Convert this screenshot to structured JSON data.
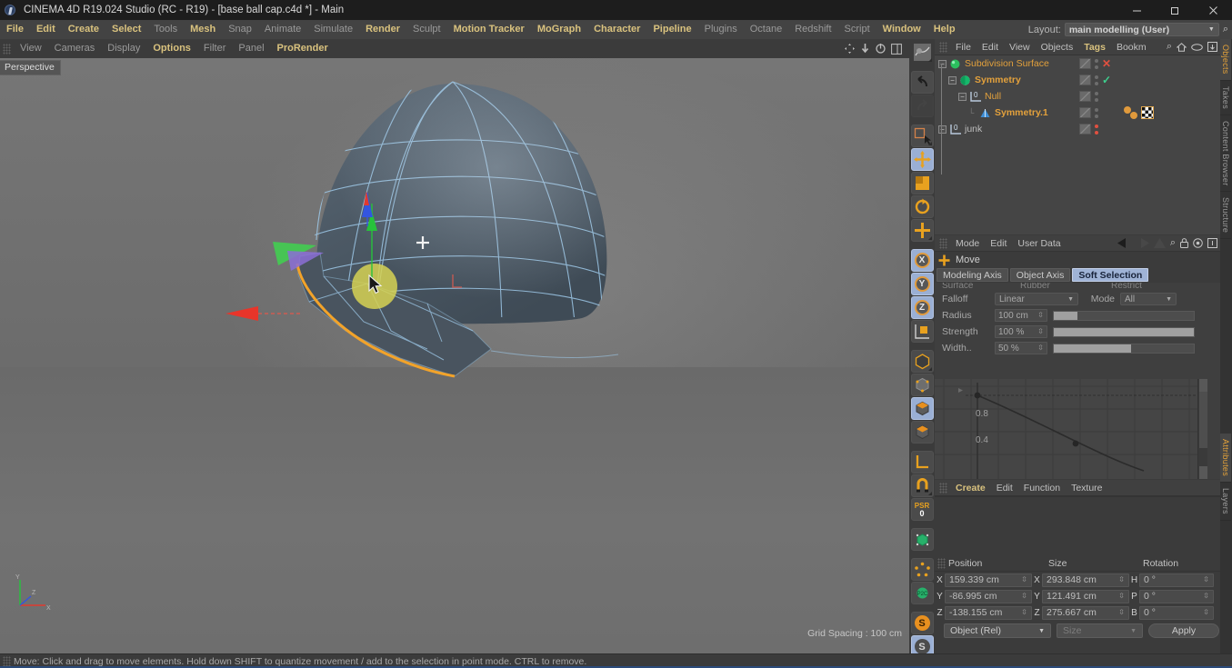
{
  "window": {
    "title": "CINEMA 4D R19.024 Studio (RC - R19) - [base ball cap.c4d *] - Main",
    "minimize": "minimize-icon",
    "maximize": "maximize-icon",
    "close": "close-icon"
  },
  "menubar": {
    "items": [
      {
        "label": "File",
        "style": "hot"
      },
      {
        "label": "Edit",
        "style": "hot"
      },
      {
        "label": "Create",
        "style": "hot"
      },
      {
        "label": "Select",
        "style": "hot"
      },
      {
        "label": "Tools",
        "style": "dim"
      },
      {
        "label": "Mesh",
        "style": "hot"
      },
      {
        "label": "Snap",
        "style": "dim"
      },
      {
        "label": "Animate",
        "style": "dim"
      },
      {
        "label": "Simulate",
        "style": "dim"
      },
      {
        "label": "Render",
        "style": "hot"
      },
      {
        "label": "Sculpt",
        "style": "dim"
      },
      {
        "label": "Motion Tracker",
        "style": "hot"
      },
      {
        "label": "MoGraph",
        "style": "hot"
      },
      {
        "label": "Character",
        "style": "hot"
      },
      {
        "label": "Pipeline",
        "style": "hot"
      },
      {
        "label": "Plugins",
        "style": "dim"
      },
      {
        "label": "Octane",
        "style": "dim"
      },
      {
        "label": "Redshift",
        "style": "dim"
      },
      {
        "label": "Script",
        "style": "dim"
      },
      {
        "label": "Window",
        "style": "hot"
      },
      {
        "label": "Help",
        "style": "hot"
      }
    ],
    "layout_label": "Layout:",
    "layout_value": "main modelling (User)",
    "search_icon": "search-icon"
  },
  "viewport_menu": {
    "items": [
      {
        "label": "View",
        "style": "dim"
      },
      {
        "label": "Cameras",
        "style": "dim"
      },
      {
        "label": "Display",
        "style": "dim"
      },
      {
        "label": "Options",
        "style": "hot"
      },
      {
        "label": "Filter",
        "style": "dim"
      },
      {
        "label": "Panel",
        "style": "dim"
      },
      {
        "label": "ProRender",
        "style": "hot"
      }
    ],
    "nav_icons": [
      "pan-icon",
      "zoom-icon",
      "rotate-icon",
      "maximize-view-icon"
    ]
  },
  "viewport": {
    "label": "Perspective",
    "grid_spacing": "Grid Spacing : 100 cm",
    "axis_labels": {
      "x": "X",
      "y": "Y",
      "z": "Z"
    },
    "gizmo": {
      "x_axis_color": "#e03a2f",
      "y_axis_color": "#27c23c",
      "z_axis_color": "#3355e0",
      "soft_selection_color": "#d6d254",
      "selected_edge_color": "#f2a32a",
      "wireframe_color": "#9dc8e8",
      "mesh_color": "#4a5662"
    },
    "cursor": "mouse-pointer"
  },
  "right_toolbar": {
    "buttons": [
      {
        "name": "render-view-icon",
        "state": "flat"
      },
      {
        "name": "undo-icon",
        "state": "normal"
      },
      {
        "name": "redo-icon",
        "state": "disabled"
      },
      {
        "name": "live-selection-icon",
        "state": "normal"
      },
      {
        "name": "move-tool-icon",
        "state": "selected"
      },
      {
        "name": "scale-tool-icon",
        "state": "normal"
      },
      {
        "name": "rotate-tool-icon",
        "state": "normal"
      },
      {
        "name": "move-plus-icon",
        "state": "normal"
      },
      {
        "name": "x-axis-lock-icon",
        "state": "selected"
      },
      {
        "name": "y-axis-lock-icon",
        "state": "selected"
      },
      {
        "name": "z-axis-lock-icon",
        "state": "selected"
      },
      {
        "name": "world-object-axis-icon",
        "state": "normal"
      },
      {
        "name": "make-editable-icon",
        "state": "normal"
      },
      {
        "name": "model-mode-icon",
        "state": "normal"
      },
      {
        "name": "object-mode-icon",
        "state": "selected"
      },
      {
        "name": "polygon-mode-icon",
        "state": "normal"
      },
      {
        "name": "axis-mode-icon",
        "state": "normal"
      },
      {
        "name": "enable-snap-icon",
        "state": "normal"
      },
      {
        "name": "psr-zero-icon",
        "state": "normal"
      },
      {
        "name": "deformer-icon",
        "state": "normal"
      },
      {
        "name": "ring-points-icon",
        "state": "normal"
      },
      {
        "name": "ppd-icon",
        "state": "normal"
      },
      {
        "name": "s-orange-icon",
        "state": "normal"
      },
      {
        "name": "s-blue-icon",
        "state": "selected"
      }
    ],
    "psr_label": "PSR",
    "psr_value": "0",
    "s_label": "S"
  },
  "object_manager": {
    "menu": [
      "File",
      "Edit",
      "View",
      "Objects",
      "Tags",
      "Bookm"
    ],
    "menu_active": "Tags",
    "icons": [
      "search-icon",
      "home-icon",
      "eye-icon",
      "fit-icon"
    ],
    "rows": [
      {
        "name": "Subdivision Surface",
        "depth": 0,
        "icon": "subdivision-surface-icon",
        "color": "orange",
        "expanded": true,
        "tag": "x",
        "tag_color": "#e05040"
      },
      {
        "name": "Symmetry",
        "depth": 1,
        "icon": "symmetry-icon",
        "color": "orangeb",
        "expanded": true,
        "tag": "check",
        "tag_color": "#3ecf8e"
      },
      {
        "name": "Null",
        "depth": 2,
        "icon": "null-icon",
        "color": "orange",
        "expanded": true,
        "tag": "none"
      },
      {
        "name": "Symmetry.1",
        "depth": 3,
        "icon": "symmetry-child-icon",
        "color": "orangeb",
        "expanded": false,
        "tag": "mat",
        "tag_color": "#e09a3c"
      },
      {
        "name": "junk",
        "depth": 0,
        "icon": "null-icon",
        "color": "grey",
        "expanded": true,
        "tag": "dots",
        "tag_color": "#e05040"
      }
    ]
  },
  "attribute_manager": {
    "menu": [
      "Mode",
      "Edit",
      "User Data"
    ],
    "icons": [
      "back-arrow-icon",
      "forward-arrow-icon",
      "up-arrow-icon",
      "search-icon",
      "lock-icon",
      "target-icon",
      "fit-icon"
    ],
    "tool_icon": "move-plus-icon",
    "tool_title": "Move",
    "tabs": [
      {
        "label": "Modeling Axis",
        "active": false
      },
      {
        "label": "Object Axis",
        "active": false
      },
      {
        "label": "Soft Selection",
        "active": true
      }
    ],
    "clipped_row": [
      "Surface",
      "Rubber",
      "Restrict"
    ],
    "fields": {
      "falloff_label": "Falloff",
      "falloff_value": "Linear",
      "mode_label": "Mode",
      "mode_value": "All",
      "radius_label": "Radius",
      "radius_value": "100 cm",
      "radius_percent": 17,
      "strength_label": "Strength",
      "strength_value": "100 %",
      "strength_percent": 100,
      "width_label": "Width..",
      "width_value": "50 %",
      "width_percent": 55
    },
    "curve": {
      "y_ticks": [
        "0.8",
        "0.4"
      ],
      "point_a": {
        "x": 0.0,
        "y": 1.0
      },
      "point_b": {
        "x": 0.5,
        "y": 0.27
      }
    }
  },
  "material_manager": {
    "menu": [
      "Create",
      "Edit",
      "Function",
      "Texture"
    ],
    "menu_active": "Create"
  },
  "coordinate_manager": {
    "headers": [
      "Position",
      "Size",
      "Rotation"
    ],
    "rows": [
      {
        "pos_axis": "X",
        "pos_value": "159.339 cm",
        "size_axis": "X",
        "size_value": "293.848 cm",
        "rot_axis": "H",
        "rot_value": "0 °"
      },
      {
        "pos_axis": "Y",
        "pos_value": "-86.995 cm",
        "size_axis": "Y",
        "size_value": "121.491 cm",
        "rot_axis": "P",
        "rot_value": "0 °"
      },
      {
        "pos_axis": "Z",
        "pos_value": "-138.155 cm",
        "size_axis": "Z",
        "size_value": "275.667 cm",
        "rot_axis": "B",
        "rot_value": "0 °"
      }
    ],
    "mode_dropdown": "Object (Rel)",
    "size_dropdown": "Size",
    "apply_button": "Apply"
  },
  "vertical_tabs": {
    "upper": [
      {
        "label": "Objects",
        "active": true
      },
      {
        "label": "Takes",
        "active": false
      },
      {
        "label": "Content Browser",
        "active": false
      },
      {
        "label": "Structure",
        "active": false
      }
    ],
    "lower": [
      {
        "label": "Attributes",
        "active": true
      },
      {
        "label": "Layers",
        "active": false
      }
    ]
  },
  "status_bar": {
    "text": "Move: Click and drag to move elements. Hold down SHIFT to quantize movement / add to the selection in point mode. CTRL to remove."
  }
}
